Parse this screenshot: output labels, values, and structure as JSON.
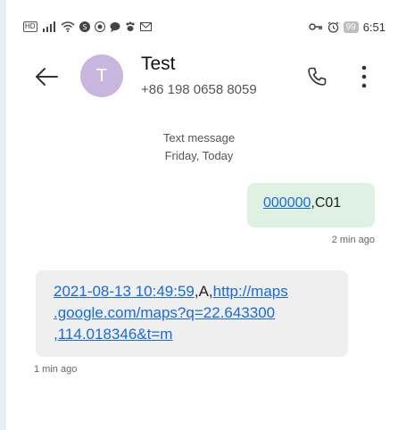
{
  "status_bar": {
    "left_icons": [
      "hd-icon",
      "signal-icon",
      "wifi-icon",
      "shield-app-icon",
      "camera-app-icon",
      "chat-app-icon",
      "paw-app-icon",
      "mail-app-icon"
    ],
    "battery": "99",
    "time": "6:51"
  },
  "header": {
    "avatar_letter": "T",
    "name": "Test",
    "number": "+86 198 0658 8059"
  },
  "divider": {
    "line1": "Text message",
    "line2": "Friday, Today"
  },
  "messages": {
    "outgoing": {
      "link_text": "000000",
      "rest_text": ",C01",
      "time": "2 min ago"
    },
    "incoming": {
      "link1": "2021-08-13 10:49:59",
      "mid": ",A,",
      "link2": "http://maps.google.com/maps?q=22.643300,114.018346&t=m",
      "time": "1 min ago"
    }
  },
  "colors": {
    "outgoing_bubble": "#dff1e2",
    "incoming_bubble": "#efefef",
    "link": "#1a6bd6",
    "avatar": "#c8b6de"
  }
}
